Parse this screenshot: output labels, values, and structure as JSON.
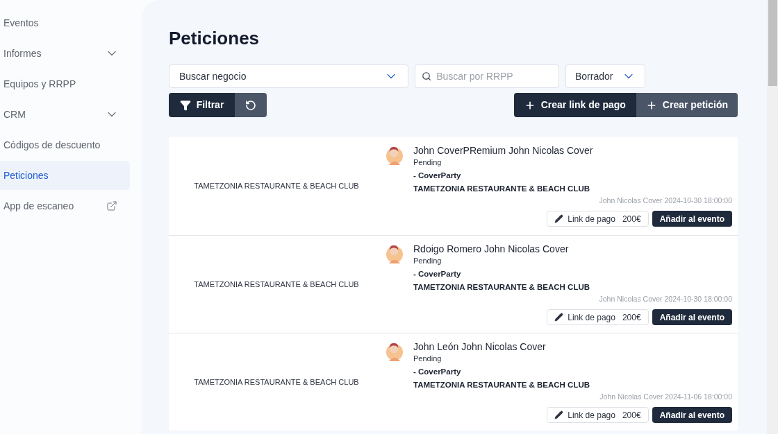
{
  "sidebar": {
    "items": [
      {
        "label": "Eventos",
        "kind": "plain",
        "selected": false
      },
      {
        "label": "Informes",
        "kind": "expandable",
        "selected": false
      },
      {
        "label": "Equipos y RRPP",
        "kind": "plain",
        "selected": false
      },
      {
        "label": "CRM",
        "kind": "expandable",
        "selected": false
      },
      {
        "label": "Códigos de descuento",
        "kind": "plain",
        "selected": false
      },
      {
        "label": "Peticiones",
        "kind": "plain",
        "selected": true
      },
      {
        "label": "App de escaneo",
        "kind": "external",
        "selected": false
      }
    ]
  },
  "page": {
    "title": "Peticiones"
  },
  "filters": {
    "business": {
      "value": "Buscar negocio"
    },
    "rrpp": {
      "placeholder": "Buscar por RRPP"
    },
    "status": {
      "value": "Borrador"
    },
    "filter_button": "Filtrar"
  },
  "actions": {
    "payment_link_button": "Crear link de pago",
    "request_button": "Crear petición"
  },
  "requests": [
    {
      "venue": "TAMETZONIA RESTAURANTE & BEACH CLUB",
      "name": "John CoverPRemium John Nicolas Cover",
      "status": "Pending",
      "event": "- CoverParty",
      "business": "TAMETZONIA RESTAURANTE & BEACH CLUB",
      "meta": "John Nicolas Cover 2024-10-30 18:00:00",
      "link_label": "Link de pago",
      "amount": "200€",
      "add_button": "Añadir al evento"
    },
    {
      "venue": "TAMETZONIA RESTAURANTE & BEACH CLUB",
      "name": "Rdoigo Romero John Nicolas Cover",
      "status": "Pending",
      "event": "- CoverParty",
      "business": "TAMETZONIA RESTAURANTE & BEACH CLUB",
      "meta": "John Nicolas Cover 2024-10-30 18:00:00",
      "link_label": "Link de pago",
      "amount": "200€",
      "add_button": "Añadir al evento"
    },
    {
      "venue": "TAMETZONIA RESTAURANTE & BEACH CLUB",
      "name": "John León John Nicolas Cover",
      "status": "Pending",
      "event": "- CoverParty",
      "business": "TAMETZONIA RESTAURANTE & BEACH CLUB",
      "meta": "John Nicolas Cover 2024-11-06 18:00:00",
      "link_label": "Link de pago",
      "amount": "200€",
      "add_button": "Añadir al evento"
    }
  ]
}
